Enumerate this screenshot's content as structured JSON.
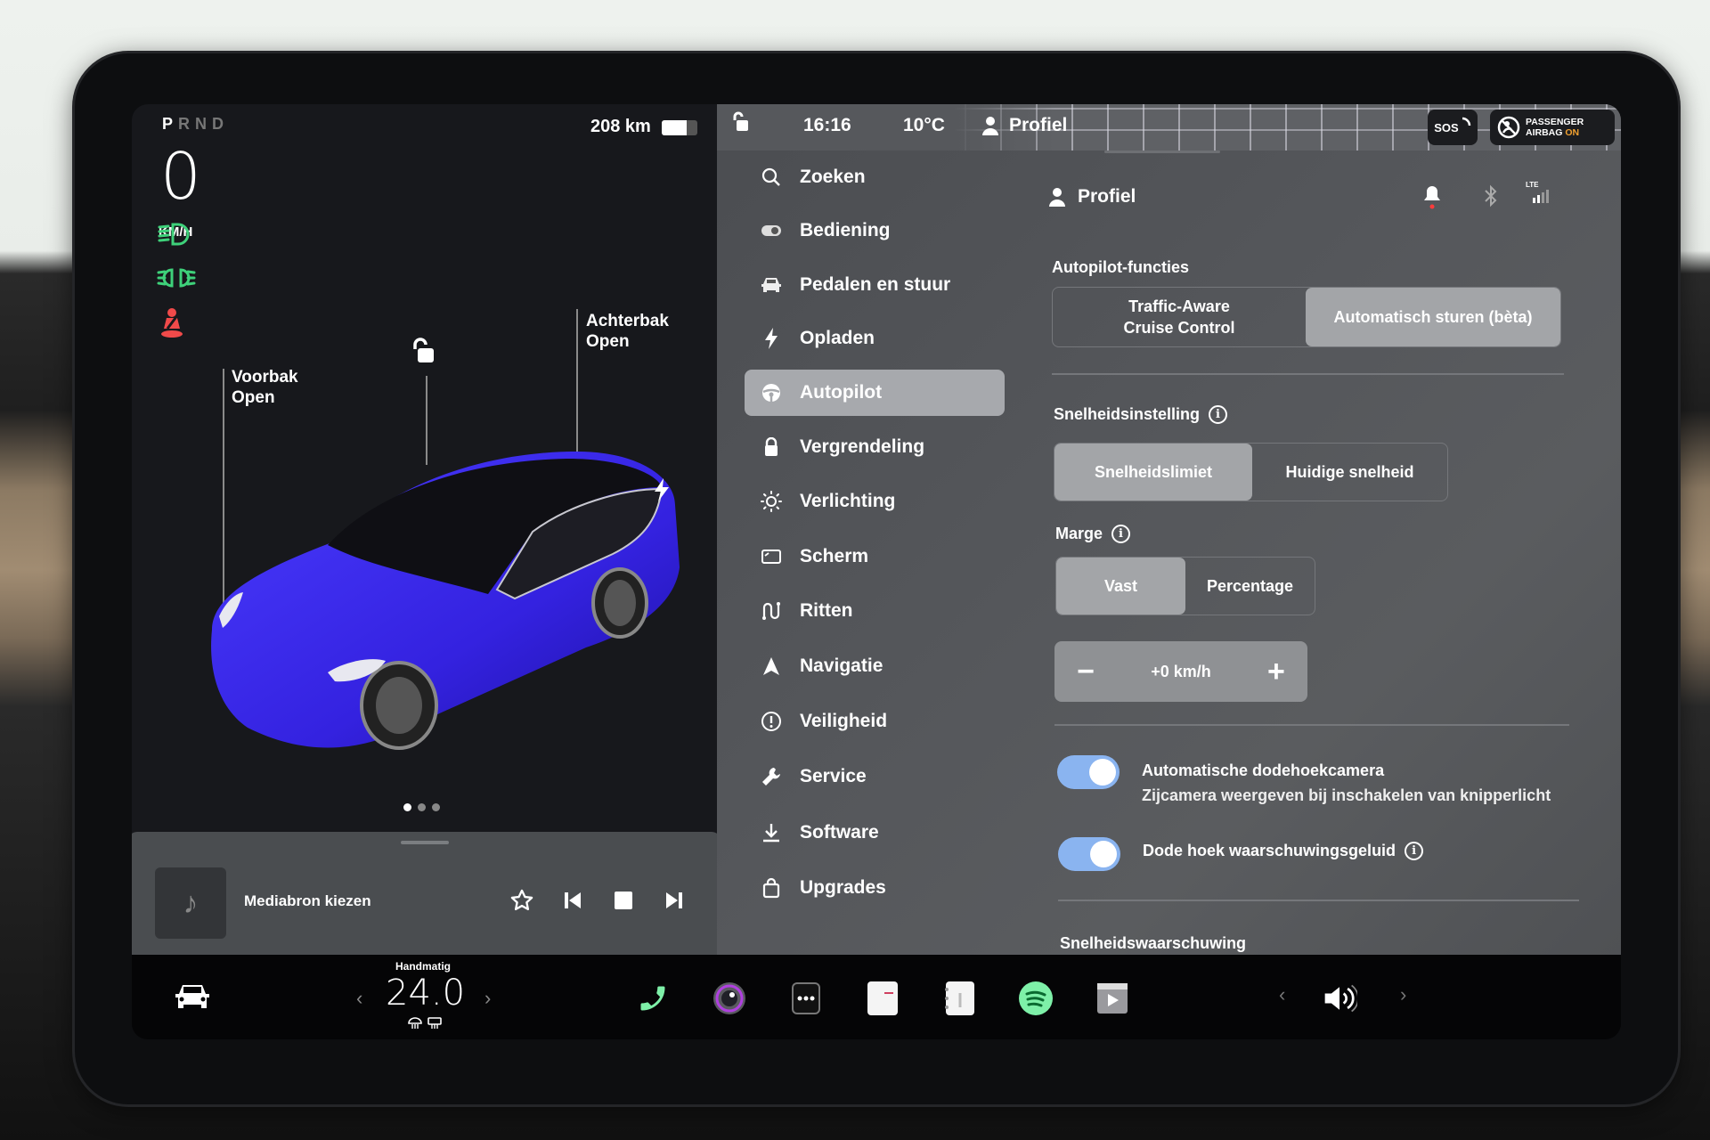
{
  "status": {
    "gear_selector": [
      "P",
      "R",
      "N",
      "D"
    ],
    "active_gear": "P",
    "speed": "0",
    "speed_unit": "KM/H",
    "range": "208 km",
    "battery_level_pct": 70,
    "time": "16:16",
    "temperature": "10°C",
    "profile": "Profiel",
    "sos_label": "SOS",
    "airbag_line1": "PASSENGER",
    "airbag_line2": "AIRBAG",
    "airbag_state": "ON"
  },
  "telltales": [
    {
      "icon": "high-beam-icon",
      "color": "#3ed17a"
    },
    {
      "icon": "parking-lights-icon",
      "color": "#3ed17a"
    },
    {
      "icon": "seatbelt-warning-icon",
      "color": "#f04a4a"
    }
  ],
  "car_view": {
    "frunk_label": "Voorbak",
    "frunk_state": "Open",
    "trunk_label": "Achterbak",
    "trunk_state": "Open",
    "car_color": "#3b2ff0",
    "page_count": 3,
    "active_page": 1
  },
  "media": {
    "source_label": "Mediabron kiezen"
  },
  "menu": {
    "items": [
      {
        "label": "Zoeken",
        "icon": "search-icon"
      },
      {
        "label": "Bediening",
        "icon": "toggle-icon"
      },
      {
        "label": "Pedalen en stuur",
        "icon": "car-icon"
      },
      {
        "label": "Opladen",
        "icon": "bolt-icon"
      },
      {
        "label": "Autopilot",
        "icon": "steering-wheel-icon",
        "active": true
      },
      {
        "label": "Vergrendeling",
        "icon": "lock-icon"
      },
      {
        "label": "Verlichting",
        "icon": "light-icon"
      },
      {
        "label": "Scherm",
        "icon": "display-icon"
      },
      {
        "label": "Ritten",
        "icon": "trips-icon"
      },
      {
        "label": "Navigatie",
        "icon": "navigation-icon"
      },
      {
        "label": "Veiligheid",
        "icon": "safety-icon"
      },
      {
        "label": "Service",
        "icon": "wrench-icon"
      },
      {
        "label": "Software",
        "icon": "download-icon"
      },
      {
        "label": "Upgrades",
        "icon": "bag-icon"
      }
    ]
  },
  "panel": {
    "profile_label": "Profiel",
    "lte_label": "LTE",
    "autopilot_features": {
      "label": "Autopilot-functies",
      "options": [
        "Traffic-Aware Cruise Control",
        "Automatisch sturen (bèta)"
      ],
      "option1_line1": "Traffic-Aware",
      "option1_line2": "Cruise Control",
      "selected": "Automatisch sturen (bèta)"
    },
    "speed_setting": {
      "label": "Snelheidsinstelling",
      "options": [
        "Snelheidslimiet",
        "Huidige snelheid"
      ],
      "selected": "Snelheidslimiet"
    },
    "margin": {
      "label": "Marge",
      "options": [
        "Vast",
        "Percentage"
      ],
      "selected": "Vast",
      "value": "+0 km/h",
      "minus": "−",
      "plus": "+"
    },
    "toggles": [
      {
        "title": "Automatische dodehoekcamera",
        "subtitle": "Zijcamera weergeven bij inschakelen van knipperlicht",
        "on": true
      },
      {
        "title": "Dode hoek waarschuwingsgeluid",
        "on": true,
        "has_info": true
      }
    ],
    "next_section_label": "Snelheidswaarschuwing"
  },
  "dock": {
    "climate_mode": "Handmatig",
    "climate_temp": "24.0",
    "apps": [
      "phone-icon",
      "camera-icon",
      "more-icon",
      "calendar-icon",
      "notes-icon",
      "spotify-icon",
      "video-icon"
    ],
    "volume_icon": "volume-icon"
  }
}
